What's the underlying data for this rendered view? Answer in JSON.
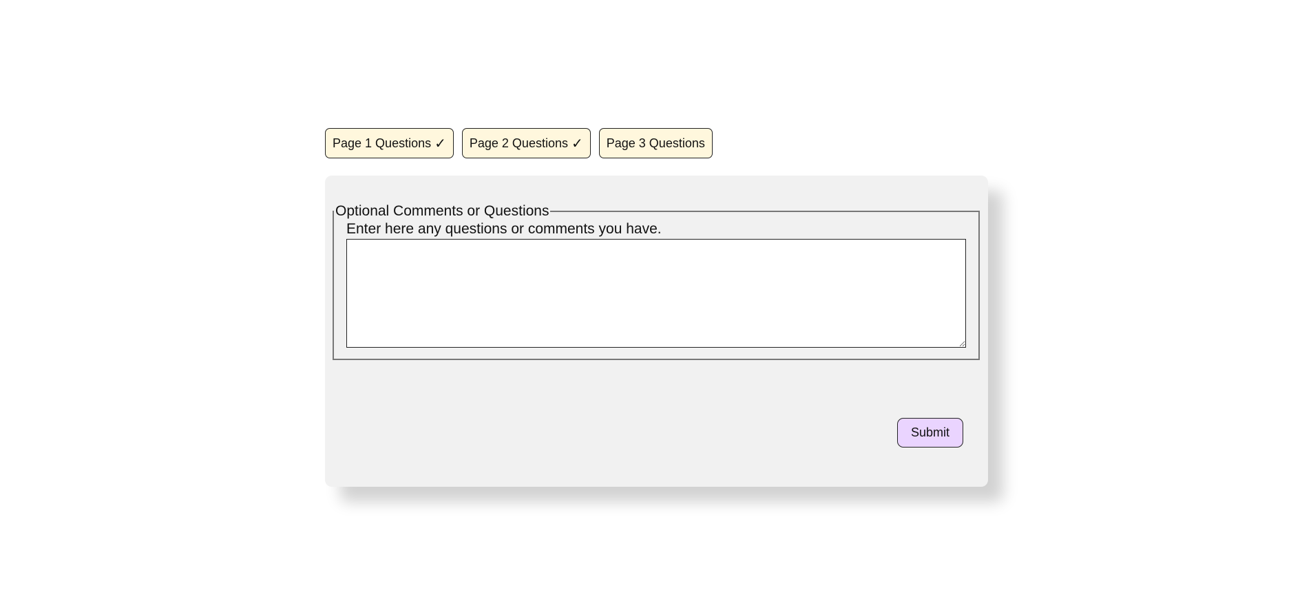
{
  "tabs": [
    {
      "label": "Page 1 Questions",
      "completed": true,
      "check": "✓"
    },
    {
      "label": "Page 2 Questions",
      "completed": true,
      "check": "✓"
    },
    {
      "label": "Page 3 Questions",
      "completed": false
    }
  ],
  "form": {
    "legend": "Optional Comments or Questions",
    "prompt": "Enter here any questions or comments you have.",
    "comments_value": ""
  },
  "actions": {
    "submit_label": "Submit"
  },
  "colors": {
    "tab_bg": "#fff7dd",
    "panel_bg": "#f1f1f1",
    "submit_bg": "#ead4ff"
  }
}
